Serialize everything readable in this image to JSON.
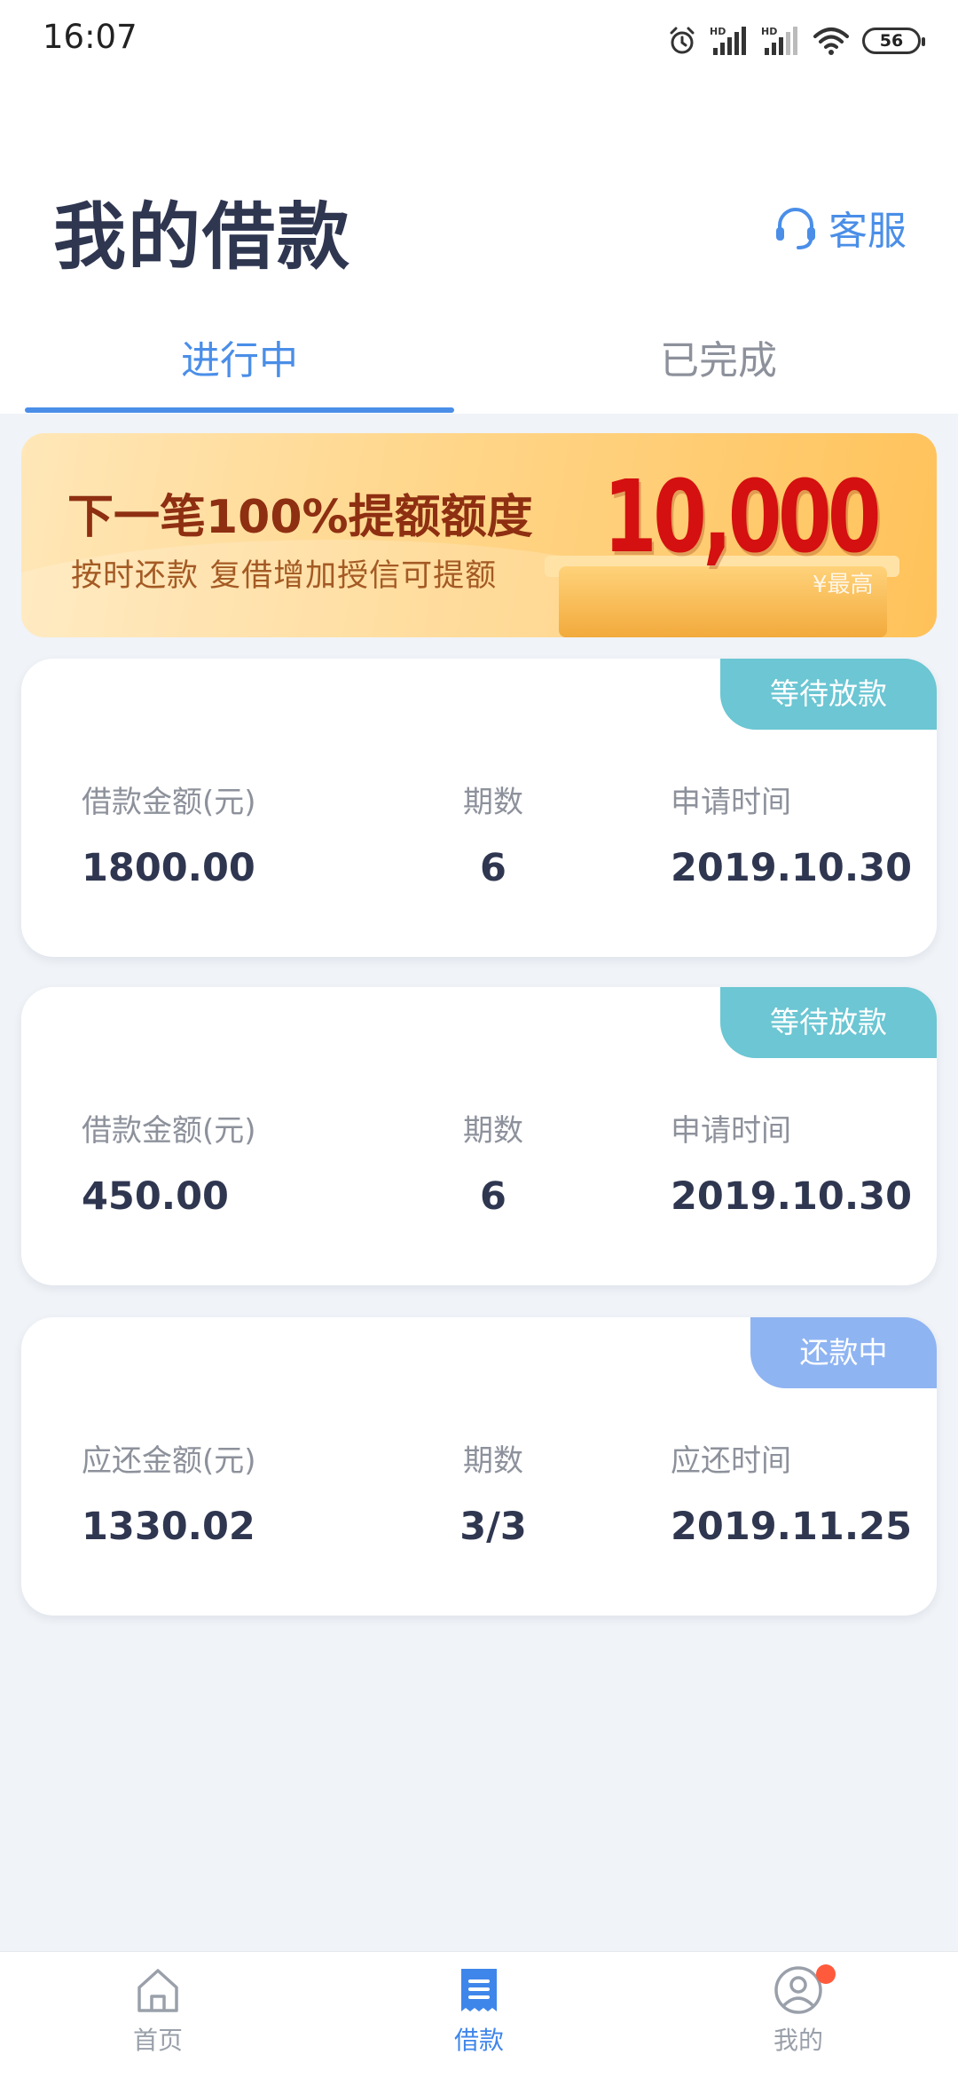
{
  "status_bar": {
    "time": "16:07",
    "network_label_1": "HD",
    "network_label_2": "HD",
    "battery": "56"
  },
  "header": {
    "title": "我的借款",
    "service_label": "客服",
    "service_icon": "headset-icon"
  },
  "tabs": [
    {
      "label": "进行中",
      "active": true
    },
    {
      "label": "已完成",
      "active": false
    }
  ],
  "banner": {
    "headline": "下一笔100%提额额度",
    "subline": "按时还款  复借增加授信可提额",
    "amount": "10,000",
    "max_label": "¥最高"
  },
  "loans": [
    {
      "status": "等待放款",
      "amount_label": "借款金额(元)",
      "amount": "1800.00",
      "periods_label": "期数",
      "periods": "6",
      "date_label": "申请时间",
      "date": "2019.10.30"
    },
    {
      "status": "等待放款",
      "amount_label": "借款金额(元)",
      "amount": "450.00",
      "periods_label": "期数",
      "periods": "6",
      "date_label": "申请时间",
      "date": "2019.10.30"
    },
    {
      "status": "还款中",
      "amount_label": "应还金额(元)",
      "amount": "1330.02",
      "periods_label": "期数",
      "periods": "3/3",
      "date_label": "应还时间",
      "date": "2019.11.25"
    }
  ],
  "bottom_nav": [
    {
      "label": "首页",
      "icon": "home-icon",
      "active": false
    },
    {
      "label": "借款",
      "icon": "bill-icon",
      "active": true
    },
    {
      "label": "我的",
      "icon": "user-icon",
      "active": false,
      "has_badge": true
    }
  ],
  "colors": {
    "accent": "#4a8ee8",
    "badge_waiting": "#6cc6d3",
    "badge_repaying": "#8fb4f2",
    "banner_amount": "#d41010",
    "notification_dot": "#ff5a3c"
  }
}
